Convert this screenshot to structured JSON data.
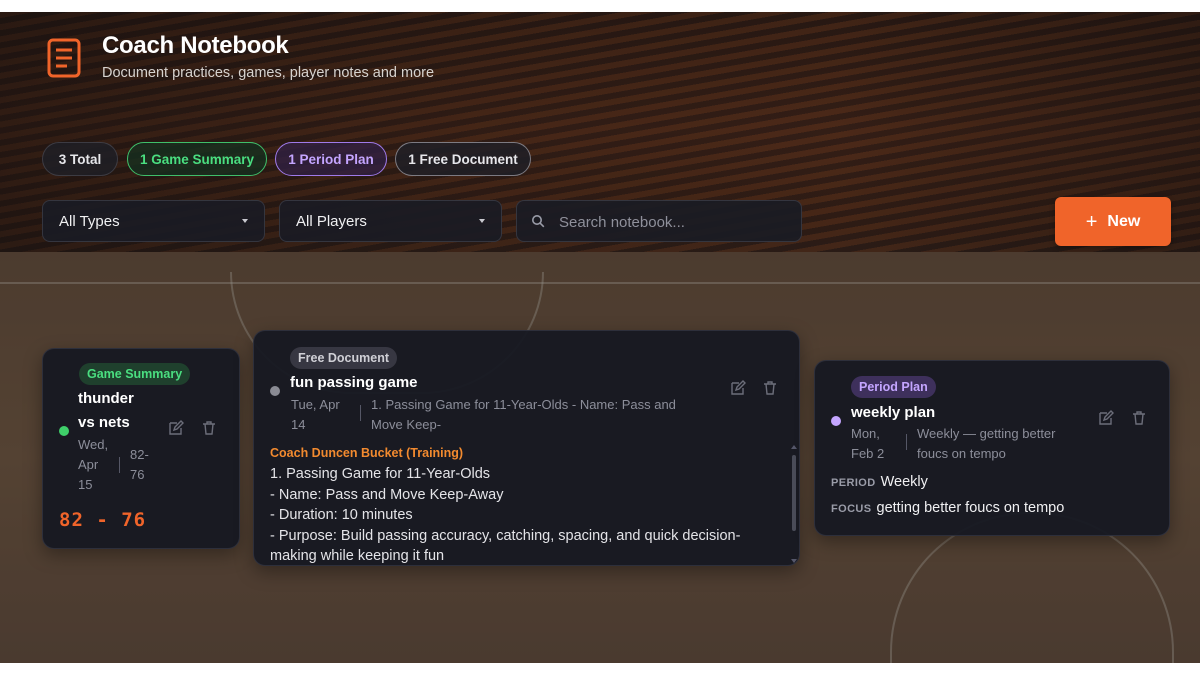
{
  "header": {
    "title": "Coach Notebook",
    "subtitle": "Document practices, games, player notes and more",
    "logo_icon": "notebook-icon"
  },
  "counts": {
    "total": "3 Total",
    "game_summary": "1 Game Summary",
    "period_plan": "1 Period Plan",
    "free_document": "1 Free Document"
  },
  "filters": {
    "type": "All Types",
    "player": "All Players",
    "search_placeholder": "Search notebook..."
  },
  "new_button": "New",
  "colors": {
    "accent": "#f0642a",
    "game_summary": "#4ade80",
    "period_plan": "#c4a5ff",
    "card_bg": "#161822"
  },
  "cards": [
    {
      "type": "Game Summary",
      "title_lines": [
        "thunder",
        "vs nets"
      ],
      "date_lines": [
        "Wed,",
        "Apr",
        "15"
      ],
      "score_lines": [
        "82-",
        "76"
      ],
      "score_big": "82 - 76"
    },
    {
      "type": "Free Document",
      "title": "fun passing game",
      "date_lines": [
        "Tue, Apr",
        "14"
      ],
      "preview_lines": [
        "1. Passing Game for 11-Year-Olds - Name: Pass and",
        "Move Keep-"
      ],
      "author": "Coach Duncen Bucket (Training)",
      "body_lines": [
        "1. Passing Game for 11-Year-Olds",
        "- Name: Pass and Move Keep-Away",
        "- Duration: 10 minutes",
        "- Purpose: Build passing accuracy, catching, spacing, and quick decision-",
        "making while keeping it fun"
      ]
    },
    {
      "type": "Period Plan",
      "title": "weekly plan",
      "date_lines": [
        "Mon,",
        "Feb 2"
      ],
      "preview_lines": [
        "Weekly — getting better",
        "foucs on tempo"
      ],
      "period_label": "PERIOD",
      "period_value": "Weekly",
      "focus_label": "FOCUS",
      "focus_value": "getting better foucs on tempo"
    }
  ]
}
